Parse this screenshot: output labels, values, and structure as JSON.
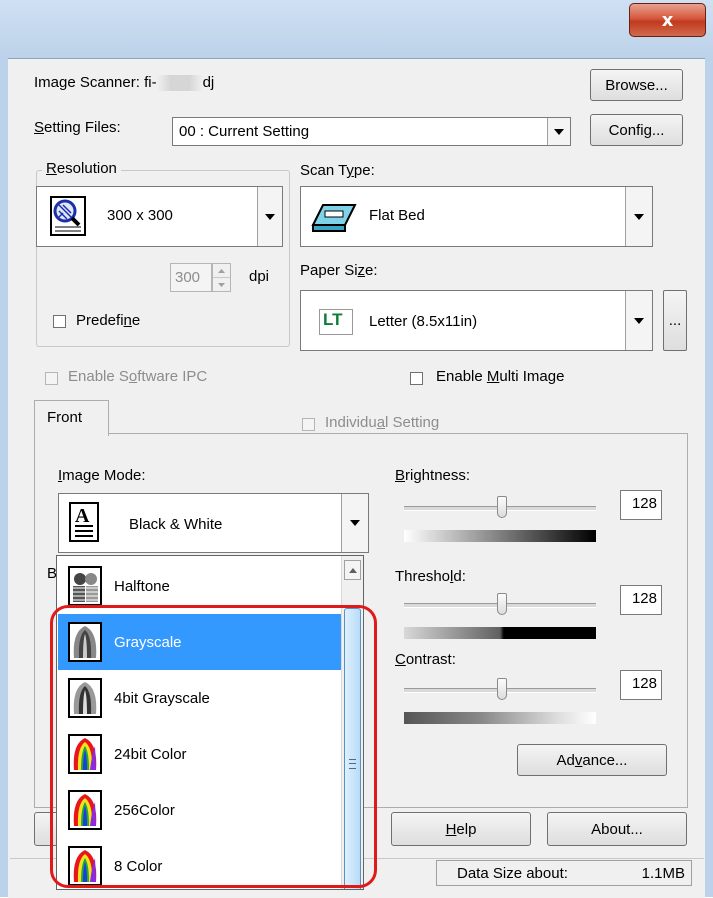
{
  "window": {
    "close_label": "x"
  },
  "scanner": {
    "label": "Image Scanner:",
    "value_prefix": "fi-",
    "value_suffix": "dj",
    "browse_label": "Browse..."
  },
  "settings": {
    "label": "Setting Files:",
    "value": "00 : Current Setting",
    "config_label": "Config..."
  },
  "resolution": {
    "legend": "Resolution",
    "value": "300 x 300",
    "dpi_value": "300",
    "dpi_unit": "dpi",
    "predefine_label": "Predefine"
  },
  "scan_type": {
    "label": "Scan Type:",
    "value": "Flat Bed"
  },
  "paper_size": {
    "label": "Paper Size:",
    "icon_text": "LT",
    "value": "Letter (8.5x11in)",
    "more_label": "..."
  },
  "enable_ipc": {
    "label": "Enable Software IPC"
  },
  "enable_multi": {
    "label": "Enable Multi Image"
  },
  "tabs": {
    "front": "Front",
    "individual_setting": "Individual Setting"
  },
  "image_mode": {
    "label": "Image Mode:",
    "value": "Black & White",
    "partial_label": "B"
  },
  "brightness": {
    "label": "Brightness:",
    "value": "128",
    "level": 0.5
  },
  "threshold": {
    "label": "Threshold:",
    "value": "128",
    "level": 0.5
  },
  "contrast": {
    "label": "Contrast:",
    "value": "128",
    "level": 0.5
  },
  "advance_label": "Advance...",
  "help_label": "Help",
  "about_label": "About...",
  "status": {
    "data_size_label": "Data Size about:",
    "data_size_value": "1.1MB"
  },
  "dropdown": {
    "items": [
      {
        "label": "Halftone",
        "icon": "halftone-icon"
      },
      {
        "label": "Grayscale",
        "icon": "grayscale-icon"
      },
      {
        "label": "4bit Grayscale",
        "icon": "grayscale-4bit-icon"
      },
      {
        "label": "24bit Color",
        "icon": "color-icon"
      },
      {
        "label": "256Color",
        "icon": "color-icon"
      },
      {
        "label": "8 Color",
        "icon": "color-icon"
      }
    ],
    "selected": "Grayscale"
  },
  "colors": {
    "selection": "#3399ff",
    "highlight_border": "#e0191b",
    "title_bar": "#bcd2ea",
    "close_button": "#c23a1e"
  }
}
